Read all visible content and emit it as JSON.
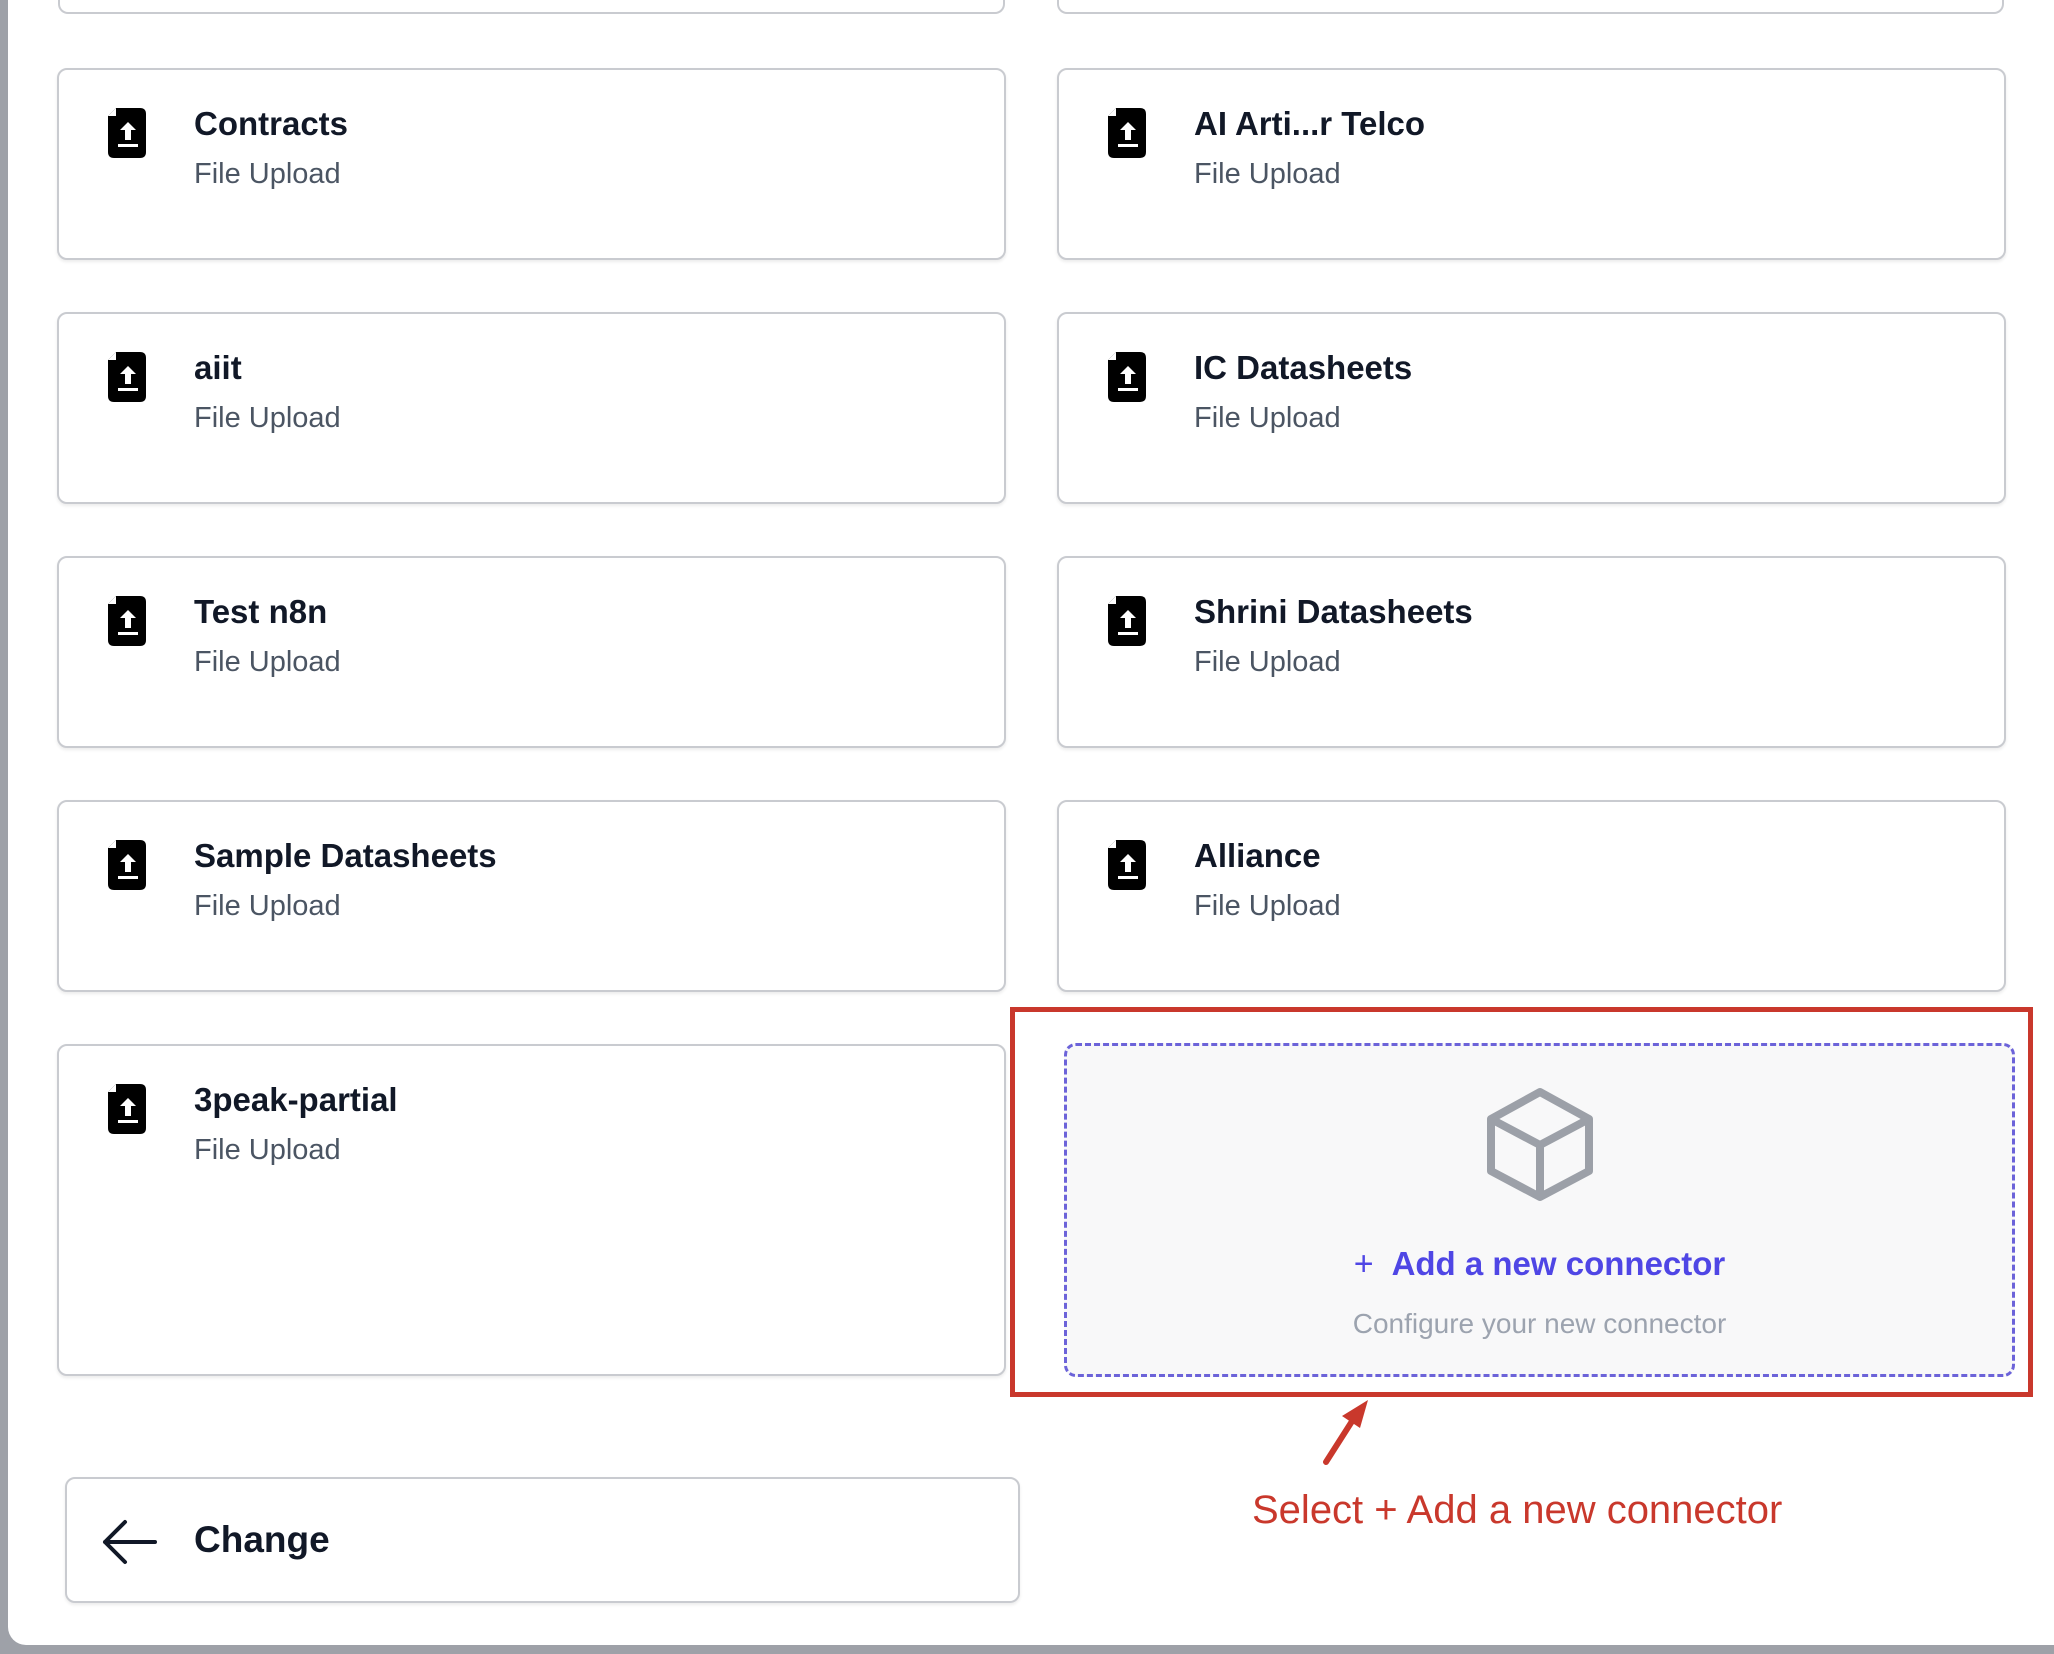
{
  "connectors": [
    {
      "name": "Contracts",
      "type": "File Upload"
    },
    {
      "name": "AI Arti...r Telco",
      "type": "File Upload"
    },
    {
      "name": "aiit",
      "type": "File Upload"
    },
    {
      "name": "IC Datasheets",
      "type": "File Upload"
    },
    {
      "name": "Test n8n",
      "type": "File Upload"
    },
    {
      "name": "Shrini Datasheets",
      "type": "File Upload"
    },
    {
      "name": "Sample Datasheets",
      "type": "File Upload"
    },
    {
      "name": "Alliance",
      "type": "File Upload"
    },
    {
      "name": "3peak-partial",
      "type": "File Upload"
    }
  ],
  "add_connector": {
    "plus": "+",
    "label": "Add a new connector",
    "subtitle": "Configure your new connector",
    "icon": "cube-icon"
  },
  "annotation": {
    "text": "Select + Add a new connector",
    "color": "#c9382c"
  },
  "change_button": {
    "label": "Change",
    "icon": "arrow-left-icon"
  },
  "colors": {
    "accent": "#4f46e5",
    "dashed_border": "#6c63d9",
    "card_border": "#c9cbd0"
  }
}
